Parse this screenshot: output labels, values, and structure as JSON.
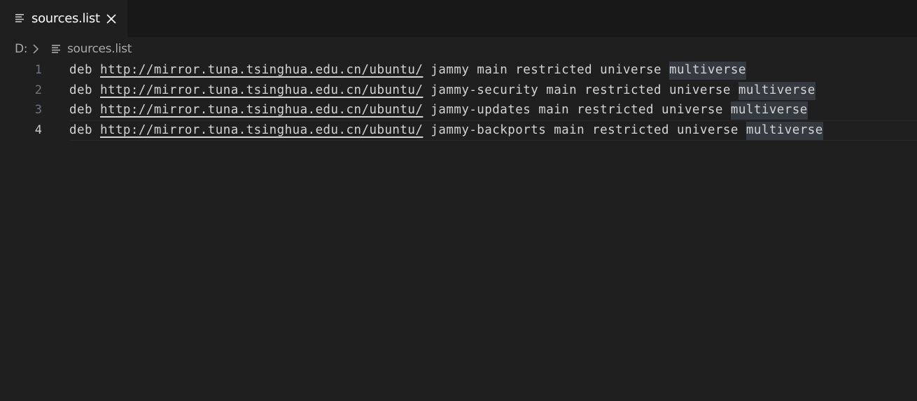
{
  "tab": {
    "title": "sources.list",
    "icon": "file-lines-icon",
    "close_icon": "close-icon"
  },
  "breadcrumb": {
    "drive": "D:",
    "separator_icon": "chevron-right-icon",
    "file_icon": "file-lines-icon",
    "file": "sources.list"
  },
  "editor": {
    "current_line": 4,
    "highlight_color": "#343a40",
    "lines": [
      {
        "number": "1",
        "type": "deb",
        "url": "http://mirror.tuna.tsinghua.edu.cn/ubuntu/",
        "suite": "jammy",
        "components": "main restricted universe",
        "highlighted": "multiverse"
      },
      {
        "number": "2",
        "type": "deb",
        "url": "http://mirror.tuna.tsinghua.edu.cn/ubuntu/",
        "suite": "jammy-security",
        "components": "main restricted universe",
        "highlighted": "multiverse"
      },
      {
        "number": "3",
        "type": "deb",
        "url": "http://mirror.tuna.tsinghua.edu.cn/ubuntu/",
        "suite": "jammy-updates",
        "components": "main restricted universe",
        "highlighted": "multiverse"
      },
      {
        "number": "4",
        "type": "deb",
        "url": "http://mirror.tuna.tsinghua.edu.cn/ubuntu/",
        "suite": "jammy-backports",
        "components": "main restricted universe",
        "highlighted": "multiverse"
      }
    ]
  }
}
